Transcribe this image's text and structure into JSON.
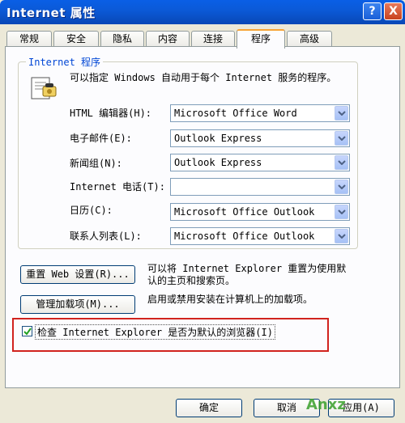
{
  "window": {
    "title": "Internet 属性",
    "help": "?",
    "close": "X"
  },
  "tabs": [
    "常规",
    "安全",
    "隐私",
    "内容",
    "连接",
    "程序",
    "高级"
  ],
  "group": {
    "label": "Internet 程序",
    "description_line1": "可以指定 Windows 自动用于每个 Internet 服务的程序。"
  },
  "programs": [
    {
      "label": "HTML 编辑器(H):",
      "value": "Microsoft Office Word"
    },
    {
      "label": "电子邮件(E):",
      "value": "Outlook Express"
    },
    {
      "label": "新闻组(N):",
      "value": "Outlook Express"
    },
    {
      "label": "Internet 电话(T):",
      "value": ""
    },
    {
      "label": "日历(C):",
      "value": "Microsoft Office Outlook"
    },
    {
      "label": "联系人列表(L):",
      "value": "Microsoft Office Outlook"
    }
  ],
  "reset": {
    "button": "重置 Web 设置(R)...",
    "text_line1": "可以将 Internet Explorer 重置为使用默",
    "text_line2": "认的主页和搜索页。"
  },
  "addons": {
    "button": "管理加载项(M)...",
    "text": "启用或禁用安装在计算机上的加载项。"
  },
  "default_check": {
    "checked": true,
    "label": "检查 Internet Explorer 是否为默认的浏览器(I)"
  },
  "footer": {
    "ok": "确定",
    "cancel": "取消",
    "apply": "应用(A)"
  },
  "watermark": "Anxz",
  "colors": {
    "highlight": "#d1231e",
    "titlebar": "#0a5fe6",
    "group_label": "#0046d5"
  }
}
